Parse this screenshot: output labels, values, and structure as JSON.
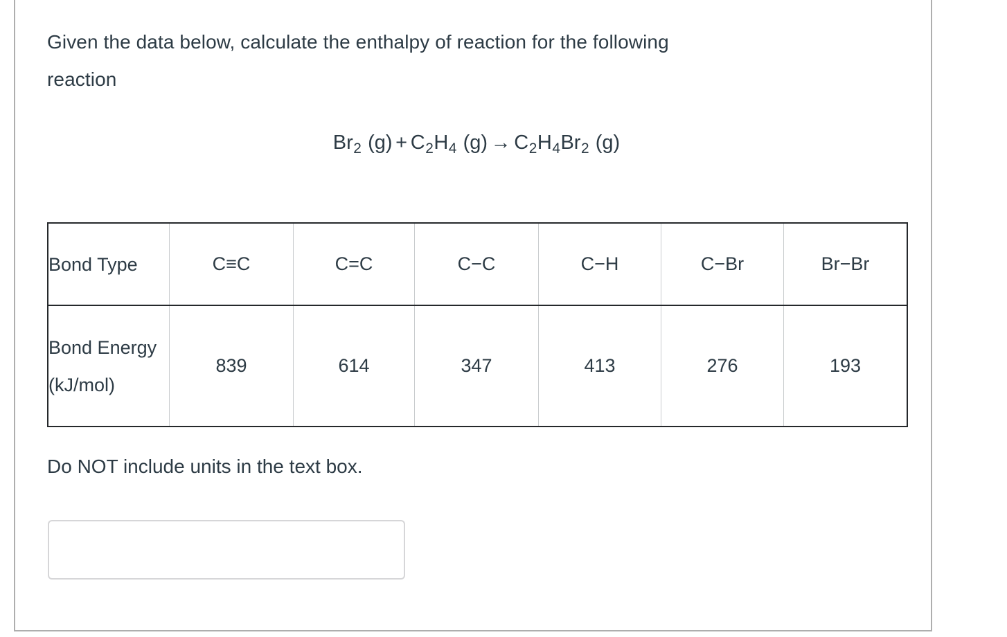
{
  "question": {
    "prompt_line_1": "Given the data below, calculate the enthalpy of reaction for the following",
    "prompt_line_2": "reaction",
    "equation": {
      "full_text": "Br2 (g) + C2H4 (g) → C2H4Br2 (g)",
      "reactant_1": {
        "symbol": "Br",
        "sub": "2",
        "state": "(g)"
      },
      "plus": "+",
      "reactant_2": {
        "symbol_a": "C",
        "sub_a": "2",
        "symbol_b": "H",
        "sub_b": "4",
        "state": "(g)"
      },
      "arrow": "→",
      "product": {
        "symbol_a": "C",
        "sub_a": "2",
        "symbol_b": "H",
        "sub_b": "4",
        "symbol_c": "Br",
        "sub_c": "2",
        "state": "(g)"
      }
    },
    "note": "Do NOT include units in the text box."
  },
  "table": {
    "row_labels": {
      "bond_type": "Bond Type",
      "bond_energy": "Bond Energy (kJ/mol)"
    },
    "bond_types": [
      "C≡C",
      "C=C",
      "C−C",
      "C−H",
      "C−Br",
      "Br−Br"
    ],
    "bond_energies": [
      "839",
      "614",
      "347",
      "413",
      "276",
      "193"
    ]
  },
  "answer": {
    "value": "",
    "placeholder": ""
  },
  "colors": {
    "text": "#2d3b45",
    "container_border": "#aeaeae",
    "table_outer_border": "#25282b",
    "table_inner_border": "#c9ccce",
    "input_border": "#d6d6d8"
  }
}
